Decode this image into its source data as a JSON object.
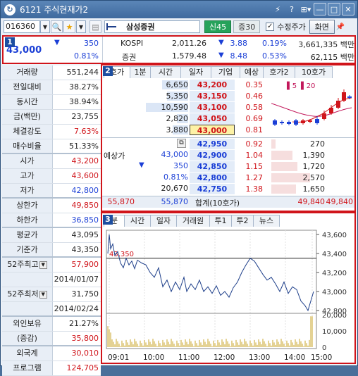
{
  "window": {
    "title": "6121 주식현재가2",
    "help": "?",
    "menu": "⊞▾",
    "minimize": "—",
    "maximize": "□",
    "close": "✕"
  },
  "toolbar": {
    "code": "016360",
    "name": "삼성증권",
    "credit": "신45",
    "margin": "증30",
    "adjusted_label": "수정주가",
    "adjusted_checked": "✓",
    "screen_button": "화면"
  },
  "quote": {
    "price": "43,000",
    "change": "350",
    "change_pct": "0.81%",
    "indices": [
      {
        "name": "KOSPI",
        "value": "2,011.26",
        "change": "3.88",
        "pct": "0.19%",
        "amount": "3,661,335 백만"
      },
      {
        "name": "증권",
        "value": "1,579.48",
        "change": "8.48",
        "pct": "0.53%",
        "amount": "62,115 백만"
      }
    ]
  },
  "stats": [
    {
      "label": "거래량",
      "value": "551,244",
      "color": "#222"
    },
    {
      "label": "전일대비",
      "value": "38.27%",
      "color": "#222"
    },
    {
      "label": "동시간",
      "value": "38.94%",
      "color": "#222"
    },
    {
      "label": "금(백만)",
      "value": "23,755",
      "color": "#222"
    },
    {
      "label": "체결강도",
      "value": "7.63%",
      "color": "#d0141a"
    },
    {
      "label": "매수비율",
      "value": "51.33%",
      "color": "#222"
    },
    {
      "label": "시가",
      "value": "43,200",
      "color": "#d0141a"
    },
    {
      "label": "고가",
      "value": "43,600",
      "color": "#d0141a"
    },
    {
      "label": "저가",
      "value": "42,800",
      "color": "#1b3fd6"
    },
    {
      "label": "상한가",
      "value": "49,850",
      "color": "#d0141a"
    },
    {
      "label": "하한가",
      "value": "36,850",
      "color": "#1b3fd6"
    },
    {
      "label": "평균가",
      "value": "43,095",
      "color": "#222"
    },
    {
      "label": "기준가",
      "value": "43,350",
      "color": "#222"
    },
    {
      "label": "52주최고",
      "value": "57,900",
      "color": "#d0141a"
    },
    {
      "label": "",
      "value": "2014/01/07",
      "color": "#222"
    },
    {
      "label": "52주최저",
      "value": "31,750",
      "color": "#222"
    },
    {
      "label": "",
      "value": "2014/02/24",
      "color": "#222"
    },
    {
      "label": "외인보유",
      "value": "21.27%",
      "color": "#222"
    },
    {
      "label": "(증감)",
      "value": "35,800",
      "color": "#d0141a"
    },
    {
      "label": "외국계",
      "value": "30,010",
      "color": "#d0141a"
    },
    {
      "label": "프로그램",
      "value": "124,705",
      "color": "#d0141a"
    }
  ],
  "orderbook": {
    "tabs": [
      "호가",
      "1분",
      "시간",
      "일자",
      "기업",
      "예상",
      "호가2",
      "10호가"
    ],
    "asks": [
      {
        "qty": "6,650",
        "price": "43,200",
        "pct": "0.35"
      },
      {
        "qty": "5,350",
        "price": "43,150",
        "pct": "0.46"
      },
      {
        "qty": "10,590",
        "price": "43,100",
        "pct": "0.58"
      },
      {
        "qty": "2,820",
        "price": "43,050",
        "pct": "0.69"
      },
      {
        "qty": "3,880",
        "price": "43,000",
        "pct": "0.81"
      }
    ],
    "bids": [
      {
        "price": "42,950",
        "pct": "0.92",
        "qty": "270"
      },
      {
        "price": "42,900",
        "pct": "1.04",
        "qty": "1,390"
      },
      {
        "price": "42,850",
        "pct": "1.15",
        "qty": "1,720"
      },
      {
        "price": "42,800",
        "pct": "1.27",
        "qty": "2,570"
      },
      {
        "price": "42,750",
        "pct": "1.38",
        "qty": "1,650"
      }
    ],
    "expected_label": "예상가",
    "expected_price": "43,000",
    "expected_change": "350",
    "expected_pct": "0.81%",
    "expected_qty": "20,670",
    "total_label": "합계(10호가)",
    "total_ask_left": "55,870",
    "total_ask": "55,870",
    "total_bid": "49,840",
    "total_bid_right": "49,840",
    "mini_legend": [
      "5",
      "20"
    ]
  },
  "intraday": {
    "tabs": [
      "분",
      "시간",
      "일자",
      "거래원",
      "투1",
      "투2",
      "뉴스"
    ],
    "ref_label": "43,350",
    "price_ticks": [
      "43,600",
      "43,400",
      "43,200",
      "43,000",
      "42,800"
    ],
    "volume_ticks": [
      "20,000",
      "10,000",
      "0"
    ],
    "time_ticks": [
      "09:01",
      "10:00",
      "11:00",
      "12:00",
      "13:00",
      "14:00",
      "15:00"
    ]
  }
}
